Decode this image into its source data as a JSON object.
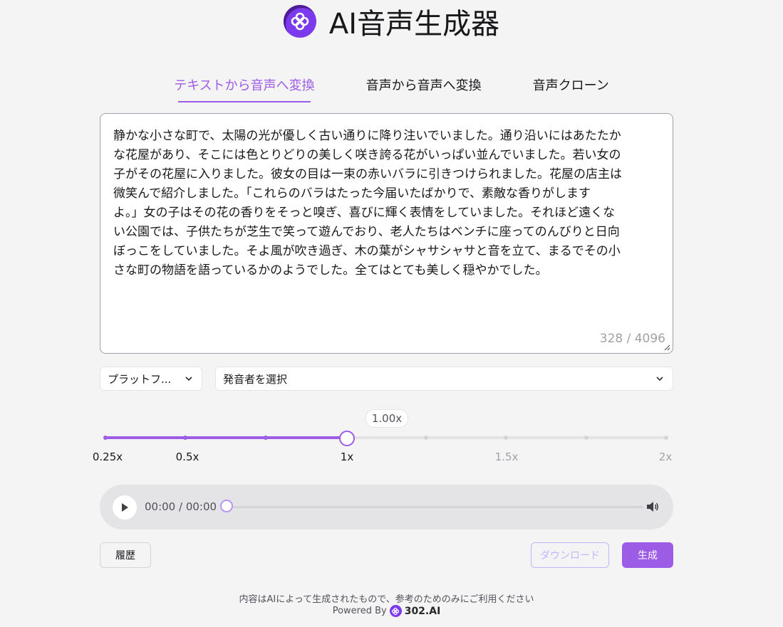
{
  "header": {
    "title": "AI音声生成器",
    "logo_icon": "flower-logo-icon"
  },
  "tabs": [
    {
      "label": "テキストから音声へ変換",
      "active": true
    },
    {
      "label": "音声から音声へ変換",
      "active": false
    },
    {
      "label": "音声クローン",
      "active": false
    }
  ],
  "editor": {
    "text": "静かな小さな町で、太陽の光が優しく古い通りに降り注いでいました。通り沿いにはあたたか\nな花屋があり、そこには色とりどりの美しく咲き誇る花がいっぱい並んでいました。若い女の\n子がその花屋に入りました。彼女の目は一束の赤いバラに引きつけられました。花屋の店主は\n微笑んで紹介しました。「これらのバラはたった今届いたばかりで、素敵な香りがします\nよ。」女の子はその花の香りをそっと嗅ぎ、喜びに輝く表情をしていました。それほど遠くな\nい公園では、子供たちが芝生で笑って遊んでおり、老人たちはベンチに座ってのんびりと日向\nぼっこをしていました。そよ風が吹き過ぎ、木の葉がシャサシャサと音を立て、まるでその小\nさな町の物語を語っているかのようでした。全てはとても美しく穏やかでした。",
    "counter": "328 / 4096"
  },
  "selects": {
    "platform": "プラットフ...",
    "speaker": "発音者を選択"
  },
  "speed": {
    "current_label": "1.00x",
    "current_value": 1.0,
    "ticks": [
      {
        "label": "0.25x",
        "value": 0.25
      },
      {
        "label": "0.5x",
        "value": 0.5
      },
      {
        "label": "1x",
        "value": 1.0
      },
      {
        "label": "1.5x",
        "value": 1.5
      },
      {
        "label": "2x",
        "value": 2.0
      }
    ],
    "accent": "#9d5ce6"
  },
  "player": {
    "time": "00:00 / 00:00",
    "progress": 0
  },
  "buttons": {
    "history": "履歴",
    "download": "ダウンロード",
    "generate": "生成"
  },
  "footer": {
    "note": "内容はAIによって生成されたもので、参考のためのみにご利用ください",
    "powered_by": "Powered By",
    "brand": "302.AI"
  }
}
